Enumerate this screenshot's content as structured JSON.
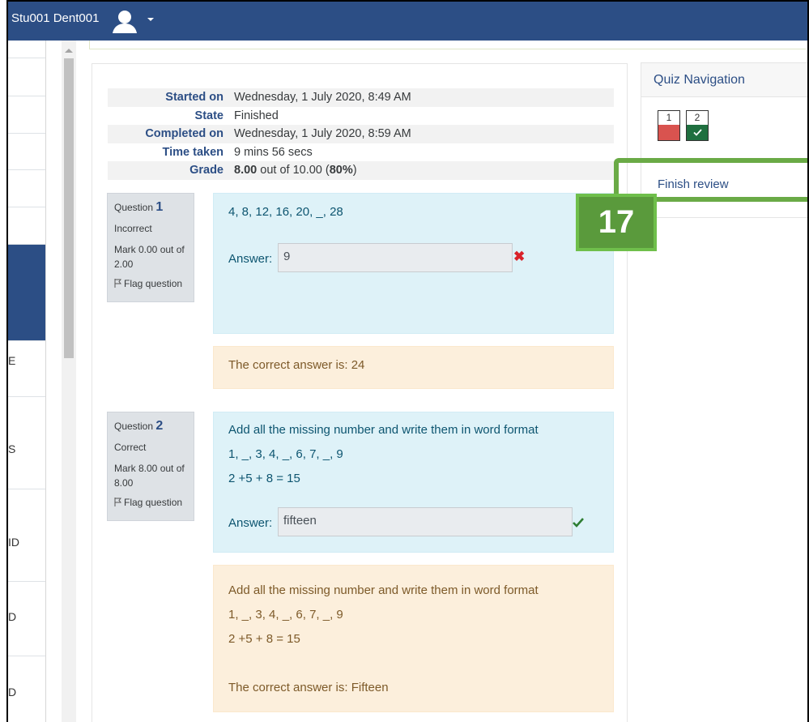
{
  "header": {
    "user_name": "Stu001 Dent001"
  },
  "left_panel": {
    "partial_labels": [
      "E",
      "S",
      "ID",
      "D",
      "D"
    ]
  },
  "summary": {
    "rows": [
      {
        "label": "Started on",
        "value": "Wednesday, 1 July 2020, 8:49 AM"
      },
      {
        "label": "State",
        "value": "Finished"
      },
      {
        "label": "Completed on",
        "value": "Wednesday, 1 July 2020, 8:59 AM"
      },
      {
        "label": "Time taken",
        "value": "9 mins 56 secs"
      }
    ],
    "grade_label": "Grade",
    "grade_mark": "8.00",
    "grade_mid": " out of 10.00 (",
    "grade_percent": "80%",
    "grade_end": ")"
  },
  "questions": [
    {
      "label": "Question",
      "number": "1",
      "status": "Incorrect",
      "mark": "Mark 0.00 out of 2.00",
      "flag": "Flag question",
      "text_lines": [
        "4, 8, 12, 16, 20, _, 28"
      ],
      "answer_label": "Answer:",
      "answer_value": "9",
      "outcome_lines": [
        "The correct answer is: 24"
      ]
    },
    {
      "label": "Question",
      "number": "2",
      "status": "Correct",
      "mark": "Mark 8.00 out of 8.00",
      "flag": "Flag question",
      "text_lines": [
        "Add all the missing number and write them in word format",
        "1, _, 3, 4, _, 6, 7, _, 9",
        "2 +5 + 8 = 15"
      ],
      "answer_label": "Answer:",
      "answer_value": "fifteen",
      "outcome_lines": [
        "Add all the missing number and write them in word format",
        "1, _, 3, 4, _, 6, 7, _, 9",
        "2 +5 + 8 = 15",
        "The correct answer is: Fifteen"
      ]
    }
  ],
  "quiz_nav": {
    "title": "Quiz Navigation",
    "buttons": [
      {
        "number": "1",
        "state": "incorrect"
      },
      {
        "number": "2",
        "state": "correct"
      }
    ],
    "finish_review": "Finish review"
  },
  "step_badge": "17",
  "colors": {
    "brand": "#2c4e85",
    "info_bg": "#def2f8",
    "outcome_bg": "#fcefdc",
    "highlight": "#6aaa46",
    "incorrect": "#d9534f",
    "correct": "#1f6f3f"
  }
}
